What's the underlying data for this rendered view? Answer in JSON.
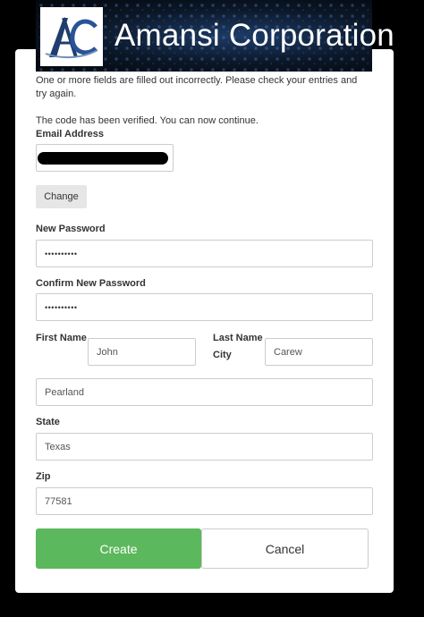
{
  "header": {
    "logo_text": "AC",
    "brand_name": "Amansi Corporation"
  },
  "messages": {
    "error": "One or more fields are filled out incorrectly. Please check your entries and try again.",
    "verified": "The code has been verified. You can now continue."
  },
  "form": {
    "email": {
      "label": "Email Address",
      "value": ""
    },
    "change_label": "Change",
    "new_password": {
      "label": "New Password",
      "value": "••••••••••"
    },
    "confirm_password": {
      "label": "Confirm New Password",
      "value": "••••••••••"
    },
    "first_name": {
      "label": "First Name",
      "value": "John"
    },
    "last_name": {
      "label": "Last Name",
      "value": "Carew"
    },
    "city": {
      "label": "City",
      "value": "Pearland"
    },
    "state": {
      "label": "State",
      "value": "Texas"
    },
    "zip": {
      "label": "Zip",
      "value": "77581"
    }
  },
  "actions": {
    "create_label": "Create",
    "cancel_label": "Cancel"
  },
  "colors": {
    "create_button": "#5cb85c",
    "banner": "#0b1626"
  }
}
